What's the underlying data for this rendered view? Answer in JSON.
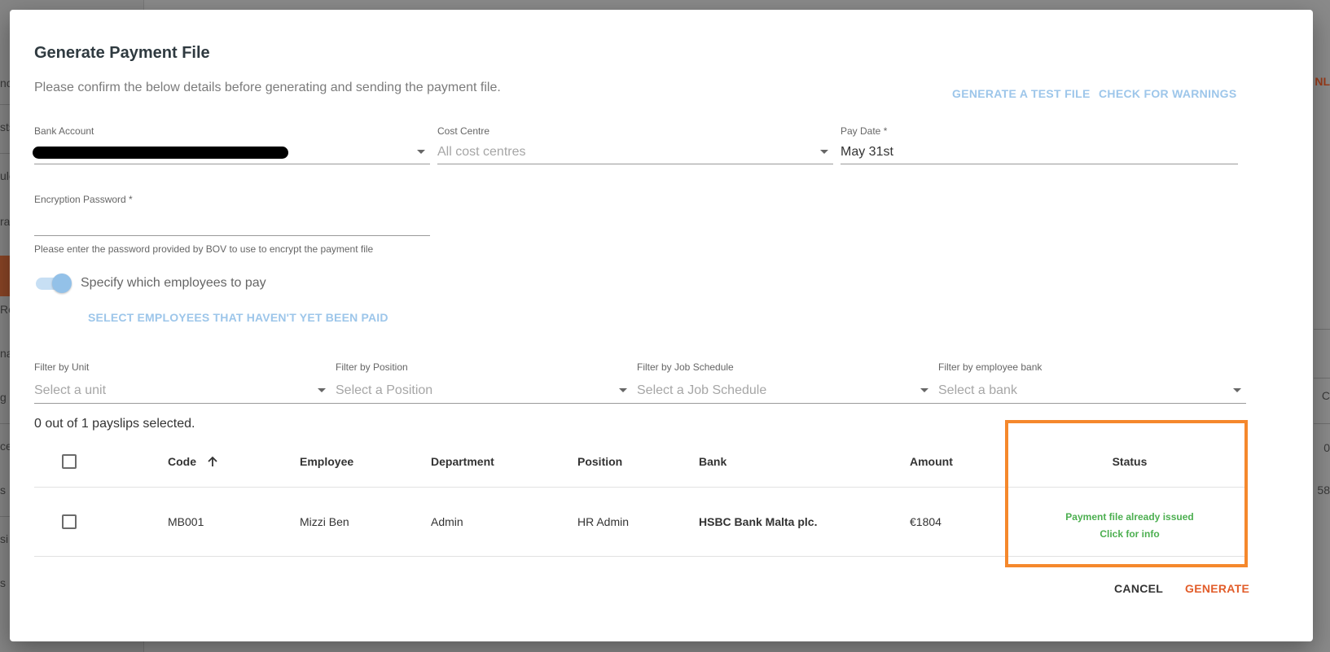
{
  "background": {
    "left_fragments": [
      "nc",
      "sts",
      "ule",
      "ra",
      "Re",
      "na",
      "g",
      "ce",
      "s",
      "si",
      "s"
    ],
    "right_fragments": [
      "NL",
      "C",
      "0",
      "58"
    ]
  },
  "modal": {
    "title": "Generate Payment File",
    "subtitle": "Please confirm the below details before generating and sending the payment file.",
    "actions": {
      "generate_test": "GENERATE A TEST FILE",
      "check_warnings": "CHECK FOR WARNINGS"
    },
    "fields": {
      "bank_account": {
        "label": "Bank Account",
        "value": ""
      },
      "cost_centre": {
        "label": "Cost Centre",
        "placeholder": "All cost centres"
      },
      "pay_date": {
        "label": "Pay Date *",
        "value": "May 31st"
      },
      "encryption_password": {
        "label": "Encryption Password *",
        "value": "",
        "helper": "Please enter the password provided by BOV to use to encrypt the payment file"
      }
    },
    "toggle": {
      "label": "Specify which employees to pay",
      "on": true
    },
    "select_unpaid": "SELECT EMPLOYEES THAT HAVEN'T YET BEEN PAID",
    "filters": {
      "unit": {
        "label": "Filter by Unit",
        "placeholder": "Select a unit"
      },
      "position": {
        "label": "Filter by Position",
        "placeholder": "Select a Position"
      },
      "job_schedule": {
        "label": "Filter by Job Schedule",
        "placeholder": "Select a Job Schedule"
      },
      "bank": {
        "label": "Filter by employee bank",
        "placeholder": "Select a bank"
      }
    },
    "selection_count": "0 out of 1 payslips selected.",
    "table": {
      "columns": {
        "code": "Code",
        "employee": "Employee",
        "department": "Department",
        "position": "Position",
        "bank": "Bank",
        "amount": "Amount",
        "status": "Status"
      },
      "rows": [
        {
          "code": "MB001",
          "employee": "Mizzi Ben",
          "department": "Admin",
          "position": "HR Admin",
          "bank": "HSBC Bank Malta plc.",
          "amount": "€1804",
          "status_line1": "Payment file already issued",
          "status_line2": "Click for info"
        }
      ]
    },
    "footer": {
      "cancel": "CANCEL",
      "generate": "GENERATE"
    },
    "colors": {
      "accent_link": "#9dc6ea",
      "status_green": "#4caf50",
      "generate_orange": "#e25d2a",
      "highlight_orange": "#f5882c"
    }
  }
}
